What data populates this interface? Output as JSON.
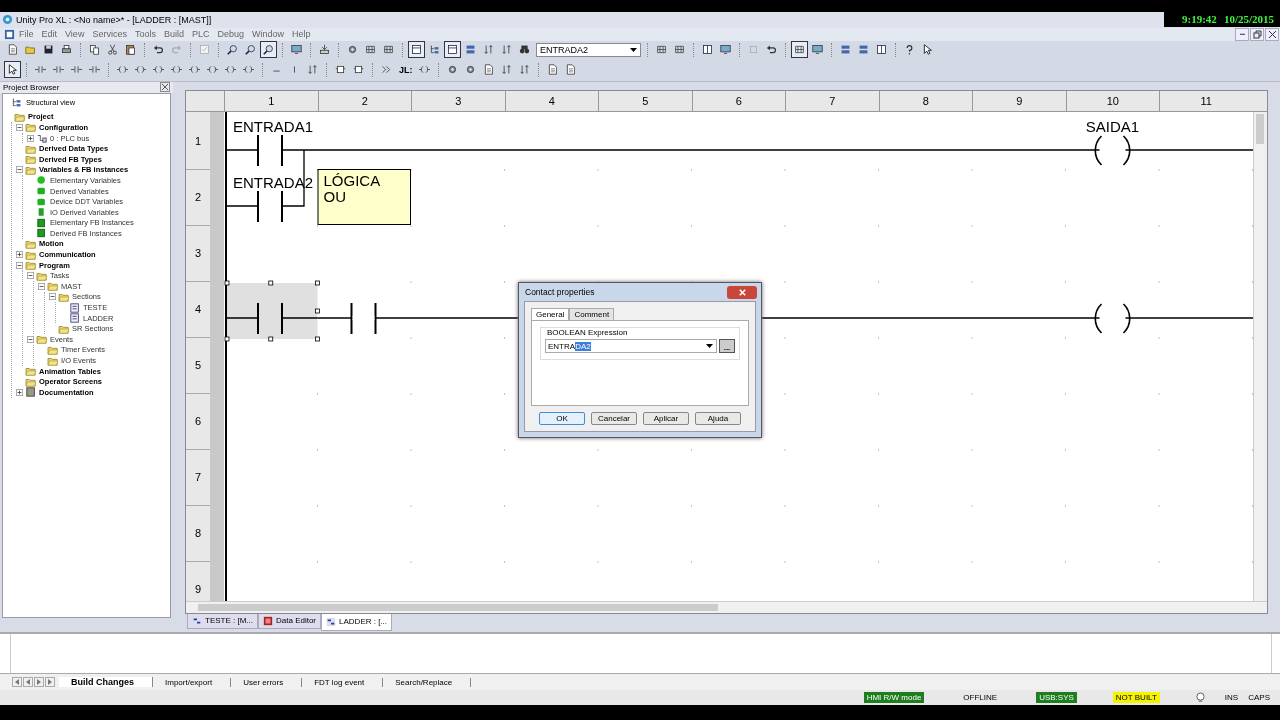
{
  "window": {
    "title": "Unity Pro XL : <No name>* - [LADDER : [MAST]]",
    "clock_time": "9:19:42",
    "clock_date": "10/25/2015"
  },
  "menu": [
    "File",
    "Edit",
    "View",
    "Services",
    "Tools",
    "Build",
    "PLC",
    "Debug",
    "Window",
    "Help"
  ],
  "toolbar": {
    "dropdown_value": "ENTRADA2",
    "buttons": [
      {
        "pressed": false
      },
      {
        "pressed": false
      },
      {
        "pressed": false
      },
      {
        "pressed": false
      },
      {
        "pressed": false
      },
      {
        "pressed": false
      },
      {
        "pressed": false
      },
      {
        "pressed": false
      },
      {
        "pressed": false
      },
      {
        "pressed": false
      },
      {
        "pressed": false
      },
      {
        "pressed": false
      },
      {
        "pressed": true
      },
      {
        "pressed": false
      },
      {
        "pressed": false
      },
      {
        "pressed": false
      },
      {
        "pressed": false
      },
      {
        "pressed": false
      },
      {
        "pressed": true
      },
      {
        "pressed": false
      },
      {
        "pressed": true
      },
      {
        "pressed": false
      },
      {
        "pressed": false
      },
      {
        "pressed": false
      },
      {
        "pressed": false
      },
      {
        "pressed": false
      },
      {
        "pressed": false
      },
      {
        "pressed": false
      },
      {
        "pressed": false
      },
      {
        "pressed": false
      },
      {
        "pressed": false
      },
      {
        "pressed": true
      },
      {
        "pressed": false
      },
      {
        "pressed": false
      },
      {
        "pressed": false
      },
      {
        "pressed": false
      },
      {
        "pressed": false
      },
      {
        "pressed": false
      }
    ]
  },
  "ladder_toolbar": {
    "jump_label": "JL:",
    "buttons": [
      {
        "pressed": true
      },
      {
        "pressed": false
      },
      {
        "pressed": false
      },
      {
        "pressed": false
      },
      {
        "pressed": false
      },
      {
        "pressed": false
      },
      {
        "pressed": false
      },
      {
        "pressed": false
      },
      {
        "pressed": false
      },
      {
        "pressed": false
      },
      {
        "pressed": false
      },
      {
        "pressed": false
      },
      {
        "pressed": false
      },
      {
        "pressed": false
      },
      {
        "pressed": false
      },
      {
        "pressed": false
      },
      {
        "pressed": false
      },
      {
        "pressed": false
      },
      {
        "pressed": false
      },
      {
        "pressed": false
      },
      {
        "pressed": false
      },
      {
        "pressed": false
      },
      {
        "pressed": false
      },
      {
        "pressed": false
      },
      {
        "pressed": false
      },
      {
        "pressed": false
      },
      {
        "pressed": false
      }
    ]
  },
  "project_browser": {
    "title": "Project Browser",
    "view_label": "Structural view",
    "tree": [
      {
        "label": "Project",
        "kind": "folder",
        "children": [
          {
            "label": "Configuration",
            "kind": "folder",
            "expanded": true,
            "children": [
              {
                "label": "0 : PLC bus",
                "kind": "bus",
                "expanded": false
              }
            ]
          },
          {
            "label": "Derived Data Types",
            "kind": "folder"
          },
          {
            "label": "Derived FB Types",
            "kind": "folder"
          },
          {
            "label": "Variables & FB instances",
            "kind": "folder",
            "expanded": true,
            "children": [
              {
                "label": "Elementary Variables",
                "kind": "variable-dot"
              },
              {
                "label": "Derived Variables",
                "kind": "variable-block"
              },
              {
                "label": "Device DDT Variables",
                "kind": "variable-block"
              },
              {
                "label": "IO Derived Variables",
                "kind": "variable-io"
              },
              {
                "label": "Elementary FB Instances",
                "kind": "fb"
              },
              {
                "label": "Derived FB Instances",
                "kind": "fb"
              }
            ]
          },
          {
            "label": "Motion",
            "kind": "folder"
          },
          {
            "label": "Communication",
            "kind": "folder",
            "expanded": false
          },
          {
            "label": "Program",
            "kind": "folder",
            "expanded": true,
            "children": [
              {
                "label": "Tasks",
                "kind": "folder",
                "expanded": true,
                "children": [
                  {
                    "label": "MAST",
                    "kind": "folder",
                    "expanded": true,
                    "children": [
                      {
                        "label": "Sections",
                        "kind": "folder",
                        "expanded": true,
                        "children": [
                          {
                            "label": "TESTE",
                            "kind": "section"
                          },
                          {
                            "label": "LADDER",
                            "kind": "section"
                          }
                        ]
                      },
                      {
                        "label": "SR Sections",
                        "kind": "folder"
                      }
                    ]
                  }
                ]
              },
              {
                "label": "Events",
                "kind": "folder",
                "expanded": true,
                "children": [
                  {
                    "label": "Timer Events",
                    "kind": "folder"
                  },
                  {
                    "label": "I/O Events",
                    "kind": "folder"
                  }
                ]
              }
            ]
          },
          {
            "label": "Animation Tables",
            "kind": "folder"
          },
          {
            "label": "Operator Screens",
            "kind": "folder"
          },
          {
            "label": "Documentation",
            "kind": "documentation",
            "expanded": false
          }
        ]
      }
    ]
  },
  "ladder": {
    "columns": [
      "1",
      "2",
      "3",
      "4",
      "5",
      "6",
      "7",
      "8",
      "9",
      "10",
      "11"
    ],
    "rows": [
      {
        "label": "1",
        "kind": "rung",
        "cells": [
          {
            "kind": "contact",
            "variable": "ENTRADA1",
            "selected": false
          },
          {
            "kind": "empty"
          },
          {
            "kind": "empty"
          },
          {
            "kind": "empty"
          },
          {
            "kind": "empty"
          },
          {
            "kind": "empty"
          },
          {
            "kind": "empty"
          },
          {
            "kind": "empty"
          },
          {
            "kind": "empty"
          },
          {
            "kind": "coil",
            "variable": "SAIDA1"
          }
        ]
      },
      {
        "label": "2",
        "kind": "branch",
        "cells": [
          {
            "kind": "contact",
            "variable": "ENTRADA2",
            "selected": false
          },
          {
            "kind": "comment",
            "lines": [
              "LÓGICA",
              "OU"
            ]
          }
        ]
      },
      {
        "label": "3"
      },
      {
        "label": "4",
        "kind": "rung",
        "cells": [
          {
            "kind": "contact",
            "selected": true
          },
          {
            "kind": "contact",
            "selected": false
          },
          {
            "kind": "empty"
          },
          {
            "kind": "empty"
          },
          {
            "kind": "empty"
          },
          {
            "kind": "empty"
          },
          {
            "kind": "empty"
          },
          {
            "kind": "empty"
          },
          {
            "kind": "empty"
          },
          {
            "kind": "coil"
          }
        ]
      },
      {
        "label": "5"
      },
      {
        "label": "6"
      },
      {
        "label": "7"
      },
      {
        "label": "8"
      },
      {
        "label": "9"
      }
    ]
  },
  "dialog": {
    "title": "Contact properties",
    "tabs": [
      {
        "label": "General",
        "selected": true
      },
      {
        "label": "Comment",
        "selected": false
      }
    ],
    "group_label": "BOOLEAN Expression",
    "value_plain": "ENTRA",
    "value_selected": "DA2",
    "browse_label": "...",
    "buttons": [
      {
        "label": "OK",
        "default": true
      },
      {
        "label": "Cancelar",
        "default": false
      },
      {
        "label": "Aplicar",
        "default": false
      },
      {
        "label": "Ajuda",
        "default": false
      }
    ]
  },
  "document_tabs": [
    {
      "label": "TESTE : [M...",
      "kind": "ladder",
      "selected": false
    },
    {
      "label": "Data Editor",
      "kind": "data",
      "selected": false
    },
    {
      "label": "LADDER : [...",
      "kind": "ladder",
      "selected": true
    }
  ],
  "output_tabs": [
    {
      "label": "Build Changes",
      "selected": true
    },
    {
      "label": "Import/export",
      "selected": false
    },
    {
      "label": "User errors",
      "selected": false
    },
    {
      "label": "FDT log event",
      "selected": false
    },
    {
      "label": "Search/Replace",
      "selected": false
    }
  ],
  "status_bar": {
    "fields": [
      {
        "text": "HMI R/W mode",
        "color": "#1e7d1e"
      },
      {
        "text": "OFFLINE"
      },
      {
        "text": "USB:SYS",
        "color": "#1e7d1e"
      },
      {
        "text": "NOT BUILT",
        "color": "#f4f400"
      }
    ],
    "keys": [
      "INS",
      "CAPS"
    ]
  }
}
